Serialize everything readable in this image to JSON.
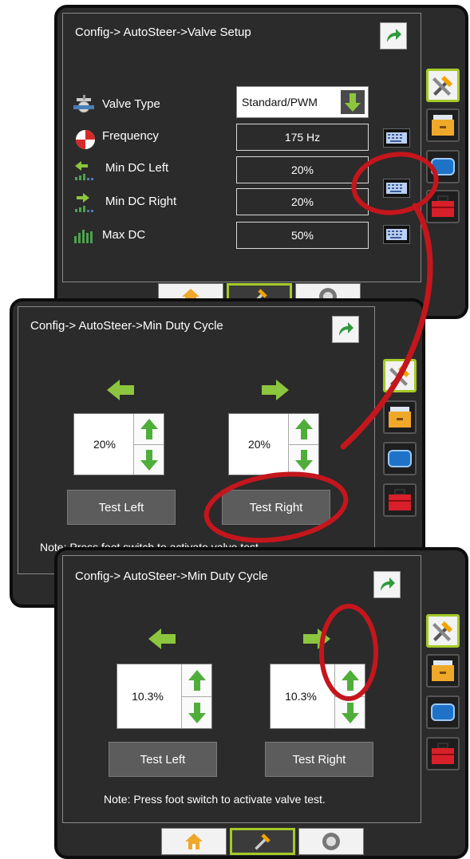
{
  "panel1": {
    "title": "Config-> AutoSteer->Valve Setup",
    "rows": [
      {
        "label": "Valve Type",
        "value": "Standard/PWM",
        "icon": "valve-icon"
      },
      {
        "label": "Frequency",
        "value": "175 Hz",
        "icon": "frequency-icon"
      },
      {
        "label": "Min DC Left",
        "value": "20%",
        "icon": "min-dc-left-icon"
      },
      {
        "label": "Min DC Right",
        "value": "20%",
        "icon": "min-dc-right-icon"
      },
      {
        "label": "Max DC",
        "value": "50%",
        "icon": "max-dc-icon"
      }
    ]
  },
  "panel2": {
    "title": "Config-> AutoSteer->Min Duty Cycle",
    "left_value": "20%",
    "right_value": "20%",
    "test_left": "Test Left",
    "test_right": "Test Right",
    "note": "Note: Press foot switch to activate valve test."
  },
  "panel3": {
    "title": "Config-> AutoSteer->Min Duty Cycle",
    "left_value": "10.3%",
    "right_value": "10.3%",
    "test_left": "Test Left",
    "test_right": "Test Right",
    "note": "Note: Press foot switch to activate valve test."
  },
  "colors": {
    "accent_green": "#8cc63f",
    "highlight_red": "#c4161c",
    "active_tab_border": "#a6c928",
    "screen_bg": "#2b2b2b"
  }
}
